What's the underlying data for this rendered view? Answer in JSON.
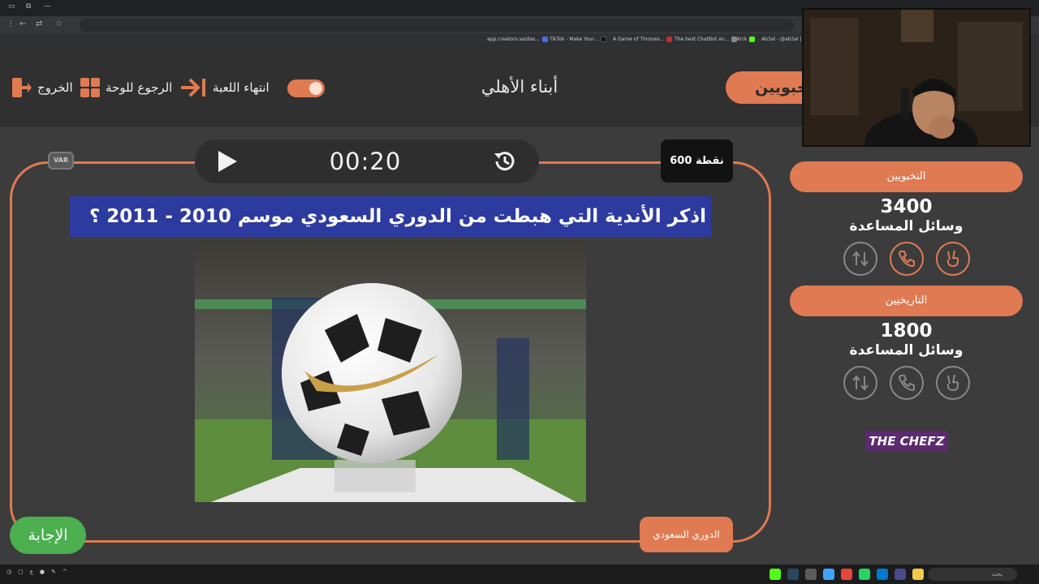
{
  "browser": {
    "bookmarks": [
      {
        "label": "app.creators.sa/das...",
        "color": "#4a6fe0"
      },
      {
        "label": "TikTok - Make Your...",
        "color": "#111111"
      },
      {
        "label": "A Game of Thrones...",
        "color": "#c92b2b"
      },
      {
        "label": "The best ChatBot an...",
        "color": "#888888"
      },
      {
        "label": "Kick",
        "color": "#53fc18"
      },
      {
        "label": "Ab3al - @ab3al |...",
        "color": "#777777"
      }
    ]
  },
  "header": {
    "exit_label": "الخروج",
    "back_to_board_label": "الرجوع للوحة",
    "end_game_label": "انتهاء اللعبة",
    "team_name": "أبناء الأهلي",
    "current_team_tab": "النخبويين"
  },
  "question_area": {
    "timer": "00:20",
    "var_label": "VAR",
    "points": "600 نقطة",
    "question_text": "اذكر الأندية التي هبطت من الدوري السعودي موسم 2010 - 2011 ؟",
    "answer_button": "الإجابة",
    "category_label": "الدوري السعودي"
  },
  "teams": [
    {
      "name": "النخبويين",
      "score": "3400",
      "aids_label": "وسائل المساعدة",
      "aids_active": true
    },
    {
      "name": "التاريخيين",
      "score": "1800",
      "aids_label": "وسائل المساعدة",
      "aids_active": false
    }
  ],
  "brand": "THE CHEFZ",
  "taskbar": {
    "search_placeholder": "بحث"
  },
  "colors": {
    "accent": "#e07a52",
    "answer_green": "#4caf50",
    "question_highlight": "#2d3aa0"
  }
}
